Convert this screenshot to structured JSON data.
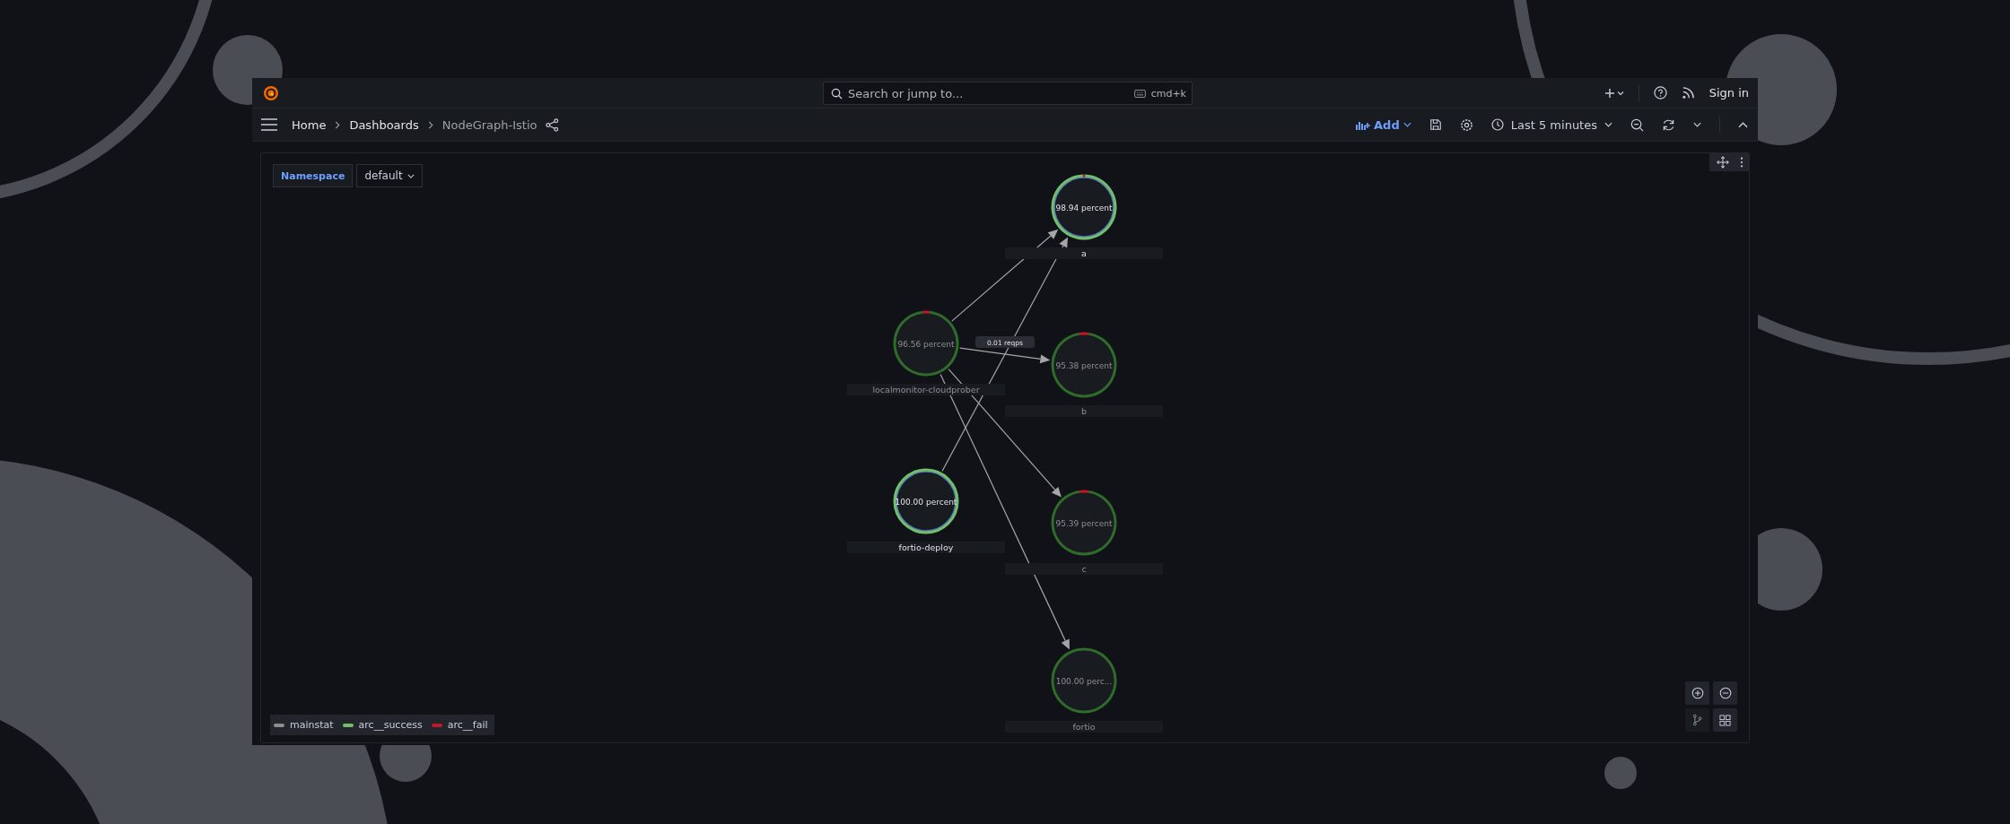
{
  "top_bar": {
    "search": {
      "placeholder": "Search or jump to...",
      "shortcut": "cmd+k"
    },
    "sign_in": "Sign in"
  },
  "nav_bar": {
    "breadcrumbs": [
      {
        "label": "Home",
        "current": false
      },
      {
        "label": "Dashboards",
        "current": false
      },
      {
        "label": "NodeGraph-Istio",
        "current": true
      }
    ],
    "add_button": "Add",
    "time_range": "Last 5 minutes"
  },
  "panel": {
    "variable": {
      "label": "Namespace",
      "value": "default"
    },
    "nodes": [
      {
        "name": "a",
        "mainstat": "98.94 percent",
        "level": 0.9894,
        "highlighted": true
      },
      {
        "name": "localmonitor-cloudprober",
        "mainstat": "96.56 percent",
        "level": 0.9656,
        "highlighted": false
      },
      {
        "name": "b",
        "mainstat": "95.38 percent",
        "level": 0.9538,
        "highlighted": false
      },
      {
        "name": "fortio-deploy",
        "mainstat": "100.00 percent",
        "level": 1.0,
        "highlighted": true
      },
      {
        "name": "c",
        "mainstat": "95.39 percent",
        "level": 0.9539,
        "highlighted": false
      },
      {
        "name": "fortio",
        "mainstat": "100.00 perc...",
        "level": 1.0,
        "highlighted": false
      }
    ],
    "edge_label": "0.01 reqps",
    "legend": [
      {
        "label": "mainstat",
        "color": "#8e8e8e"
      },
      {
        "label": "arc__success",
        "color": "#73bf69"
      },
      {
        "label": "arc__fail",
        "color": "#c4162a"
      }
    ]
  }
}
